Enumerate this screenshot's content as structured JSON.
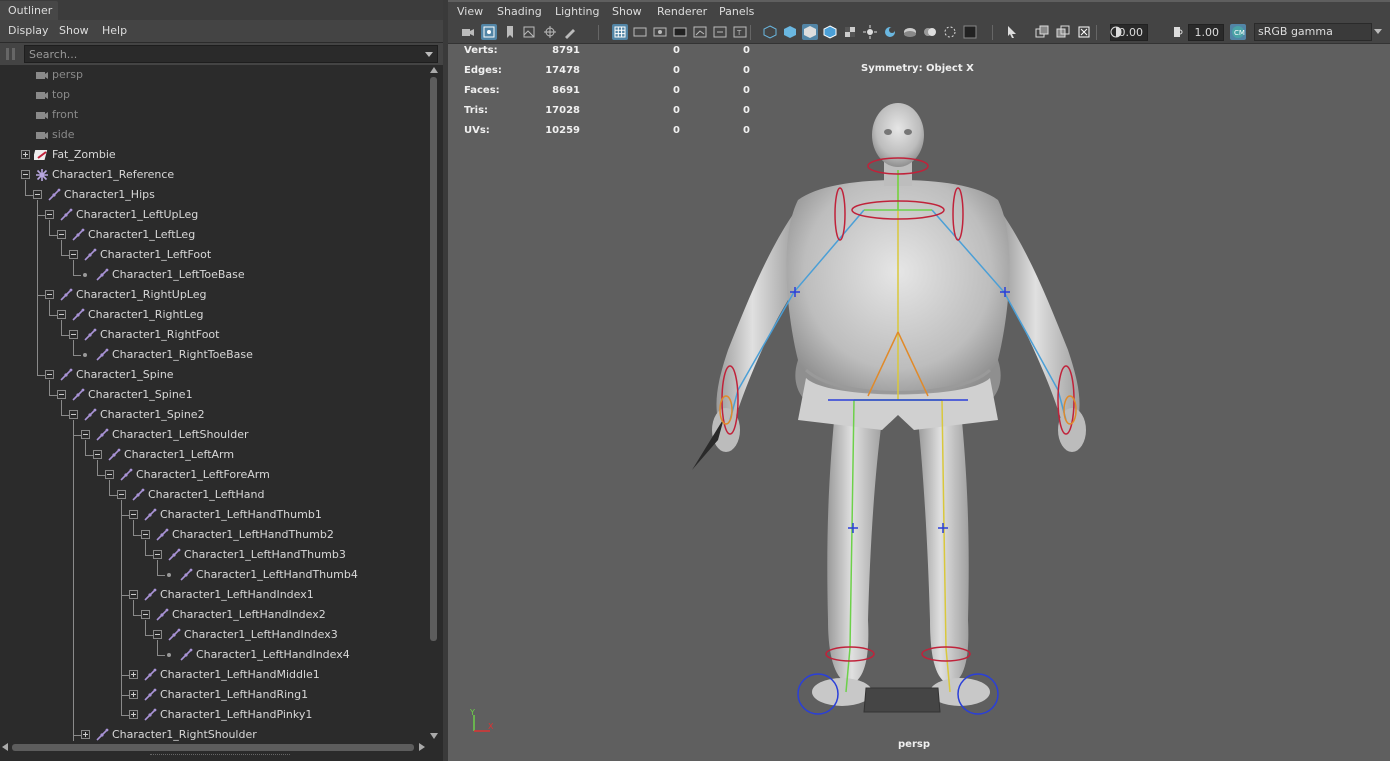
{
  "outliner": {
    "tab_title": "Outliner",
    "menu": [
      "Display",
      "Show",
      "Help"
    ],
    "search_placeholder": "Search...",
    "tree": [
      {
        "label": "persp",
        "type": "camera",
        "dim": true
      },
      {
        "label": "top",
        "type": "camera",
        "dim": true
      },
      {
        "label": "front",
        "type": "camera",
        "dim": true
      },
      {
        "label": "side",
        "type": "camera",
        "dim": true
      },
      {
        "label": "Fat_Zombie",
        "type": "mesh",
        "state": "collapsed"
      },
      {
        "label": "Character1_Reference",
        "type": "reference",
        "state": "expanded"
      },
      {
        "label": "Character1_Hips",
        "type": "joint",
        "state": "expanded"
      },
      {
        "label": "Character1_LeftUpLeg",
        "type": "joint",
        "state": "expanded"
      },
      {
        "label": "Character1_LeftLeg",
        "type": "joint",
        "state": "expanded"
      },
      {
        "label": "Character1_LeftFoot",
        "type": "joint",
        "state": "expanded"
      },
      {
        "label": "Character1_LeftToeBase",
        "type": "joint",
        "state": "leaf"
      },
      {
        "label": "Character1_RightUpLeg",
        "type": "joint",
        "state": "expanded"
      },
      {
        "label": "Character1_RightLeg",
        "type": "joint",
        "state": "expanded"
      },
      {
        "label": "Character1_RightFoot",
        "type": "joint",
        "state": "expanded"
      },
      {
        "label": "Character1_RightToeBase",
        "type": "joint",
        "state": "leaf"
      },
      {
        "label": "Character1_Spine",
        "type": "joint",
        "state": "expanded"
      },
      {
        "label": "Character1_Spine1",
        "type": "joint",
        "state": "expanded"
      },
      {
        "label": "Character1_Spine2",
        "type": "joint",
        "state": "expanded"
      },
      {
        "label": "Character1_LeftShoulder",
        "type": "joint",
        "state": "expanded"
      },
      {
        "label": "Character1_LeftArm",
        "type": "joint",
        "state": "expanded"
      },
      {
        "label": "Character1_LeftForeArm",
        "type": "joint",
        "state": "expanded"
      },
      {
        "label": "Character1_LeftHand",
        "type": "joint",
        "state": "expanded"
      },
      {
        "label": "Character1_LeftHandThumb1",
        "type": "joint",
        "state": "expanded"
      },
      {
        "label": "Character1_LeftHandThumb2",
        "type": "joint",
        "state": "expanded"
      },
      {
        "label": "Character1_LeftHandThumb3",
        "type": "joint",
        "state": "expanded"
      },
      {
        "label": "Character1_LeftHandThumb4",
        "type": "joint",
        "state": "leaf"
      },
      {
        "label": "Character1_LeftHandIndex1",
        "type": "joint",
        "state": "expanded"
      },
      {
        "label": "Character1_LeftHandIndex2",
        "type": "joint",
        "state": "expanded"
      },
      {
        "label": "Character1_LeftHandIndex3",
        "type": "joint",
        "state": "expanded"
      },
      {
        "label": "Character1_LeftHandIndex4",
        "type": "joint",
        "state": "leaf"
      },
      {
        "label": "Character1_LeftHandMiddle1",
        "type": "joint",
        "state": "collapsed"
      },
      {
        "label": "Character1_LeftHandRing1",
        "type": "joint",
        "state": "collapsed"
      },
      {
        "label": "Character1_LeftHandPinky1",
        "type": "joint",
        "state": "collapsed"
      },
      {
        "label": "Character1_RightShoulder",
        "type": "joint",
        "state": "collapsed"
      }
    ]
  },
  "viewport": {
    "menu": [
      "View",
      "Shading",
      "Lighting",
      "Show",
      "Renderer",
      "Panels"
    ],
    "exposure_value": "0.00",
    "gamma_value": "1.00",
    "color_management": "sRGB gamma",
    "camera_name": "persp",
    "symmetry_text": "Symmetry: Object X",
    "hud_stats": [
      {
        "label": "Verts:",
        "count": "8791",
        "selected": "0",
        "total": "0"
      },
      {
        "label": "Edges:",
        "count": "17478",
        "selected": "0",
        "total": "0"
      },
      {
        "label": "Faces:",
        "count": "8691",
        "selected": "0",
        "total": "0"
      },
      {
        "label": "Tris:",
        "count": "17028",
        "selected": "0",
        "total": "0"
      },
      {
        "label": "UVs:",
        "count": "10259",
        "selected": "0",
        "total": "0"
      }
    ],
    "toolbar_icons": [
      "select-camera-icon",
      "camera-attributes-icon",
      "bookmark-icon",
      "image-plane-icon",
      "2d-pan-zoom-icon",
      "grease-pencil-icon",
      "grid-icon",
      "film-gate-icon",
      "resolution-gate-icon",
      "gate-mask-icon",
      "field-chart-icon",
      "safe-action-icon",
      "safe-title-icon",
      "wireframe-icon",
      "smooth-shade-icon",
      "default-material-icon",
      "wireframe-on-shaded-icon",
      "textured-icon",
      "use-all-lights-icon",
      "shadows-icon",
      "screen-space-ao-icon",
      "motion-blur-icon",
      "multisample-aa-icon",
      "depth-of-field-icon",
      "isolate-select-icon",
      "xray-icon",
      "xray-joints-icon",
      "backface-culling-icon",
      "exposure-icon",
      "gamma-icon",
      "color-management-icon"
    ],
    "colors": {
      "joint_green": "#6dd14a",
      "joint_yellow": "#d9c83c",
      "joint_blue": "#4b9fd6",
      "control_red": "#c0223a",
      "control_blue": "#2a3fd9",
      "mesh": "#d2d2d2",
      "accent": "#5285a6"
    },
    "axis_labels": {
      "y": "Y",
      "x": "X"
    }
  }
}
